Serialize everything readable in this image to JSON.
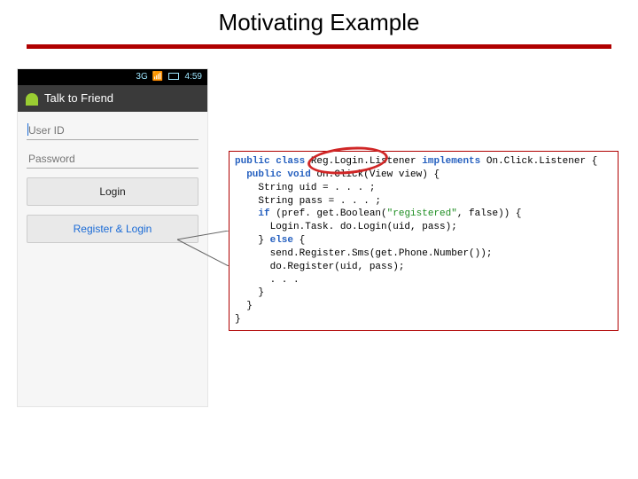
{
  "slide": {
    "title": "Motivating Example"
  },
  "phone": {
    "status_time": "4:59",
    "status_signal": "3G",
    "app_title": "Talk to Friend",
    "user_id_placeholder": "User ID",
    "password_placeholder": "Password",
    "login_label": "Login",
    "register_login_label": "Register & Login"
  },
  "code": {
    "l1a": "public",
    "l1b": " class",
    "l1c": " Reg.Login.Listener ",
    "l1d": "implements",
    "l1e": " On.Click.Listener {",
    "l2a": "  public",
    "l2b": " void",
    "l2c": " on.Click(View view) {",
    "l3": "    String uid = . . . ;",
    "l4": "    String pass = . . . ;",
    "l5a": "    if",
    "l5b": " (pref. get.Boolean(",
    "l5c": "\"registered\"",
    "l5d": ", false)) {",
    "l6": "      Login.Task. do.Login(uid, pass);",
    "l7a": "    } ",
    "l7b": "else",
    "l7c": " {",
    "l8": "      send.Register.Sms(get.Phone.Number());",
    "l9": "      do.Register(uid, pass);",
    "l10": "      . . .",
    "l11": "    }",
    "l12": "  }",
    "l13": "}"
  }
}
